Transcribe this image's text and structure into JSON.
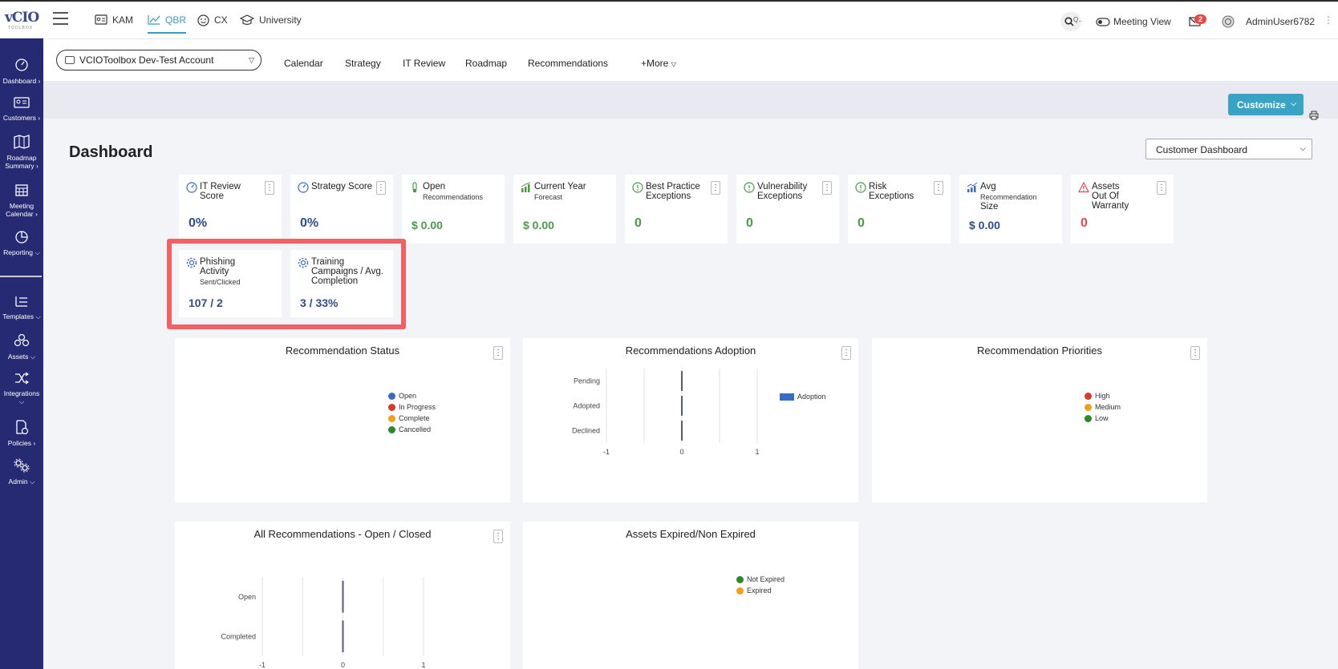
{
  "app": {
    "logo_text": "vCIO",
    "logo_sub": "TOOLBOX"
  },
  "sidebar": {
    "items": [
      {
        "label": "Dashboard",
        "icon": "gauge-icon"
      },
      {
        "label": "Customers",
        "icon": "id-card-icon"
      },
      {
        "label": "Roadmap Summary",
        "icon": "map-icon"
      },
      {
        "label": "Meeting Calendar",
        "icon": "calendar-icon"
      },
      {
        "label": "Reporting",
        "icon": "pie-chart-icon"
      },
      {
        "label": "Templates",
        "icon": "list-icon"
      },
      {
        "label": "Assets",
        "icon": "boxes-icon"
      },
      {
        "label": "Integrations",
        "icon": "shuffle-icon"
      },
      {
        "label": "Policies",
        "icon": "document-check-icon"
      },
      {
        "label": "Admin",
        "icon": "gears-icon"
      }
    ]
  },
  "topnav": {
    "tabs": [
      {
        "label": "KAM"
      },
      {
        "label": "QBR"
      },
      {
        "label": "CX"
      },
      {
        "label": "University"
      }
    ],
    "search_label": "Q..",
    "meeting_view": "Meeting View",
    "mail_count": "2",
    "username": "AdminUser6782"
  },
  "subbar": {
    "account": "VCIOToolbox Dev-Test Account",
    "tabs": [
      "Calendar",
      "Strategy",
      "IT Review",
      "Roadmap",
      "Recommendations"
    ],
    "more": "+More"
  },
  "toolbar": {
    "customize": "Customize"
  },
  "page": {
    "title": "Dashboard",
    "dashboard_select": "Customer Dashboard"
  },
  "cards": [
    {
      "title": "IT Review Score",
      "sub": "",
      "value": "0%",
      "value_color": "#2f4d8c"
    },
    {
      "title": "Strategy Score",
      "sub": "",
      "value": "0%",
      "value_color": "#2f4d8c"
    },
    {
      "title": "Open",
      "sub": "Recommendations",
      "value": "$ 0.00",
      "value_color": "#4a9a4a"
    },
    {
      "title": "Current Year",
      "sub": "Forecast",
      "value": "$ 0.00",
      "value_color": "#4a9a4a"
    },
    {
      "title": "Best Practice Exceptions",
      "sub": "",
      "value": "0",
      "value_color": "#4a9a4a"
    },
    {
      "title": "Vulnerability Exceptions",
      "sub": "",
      "value": "0",
      "value_color": "#4a9a4a"
    },
    {
      "title": "Risk Exceptions",
      "sub": "",
      "value": "0",
      "value_color": "#4a9a4a"
    },
    {
      "title": "Avg",
      "sub": "Recommendation",
      "title2": "Size",
      "value": "$ 0.00",
      "value_color": "#2f4d8c"
    },
    {
      "title": "Assets Out Of Warranty",
      "sub": "",
      "value": "0",
      "value_color": "#e84a4a"
    },
    {
      "title": "Phishing Activity",
      "sub": "Sent/Clicked",
      "value": "107 / 2",
      "value_color": "#2f4d8c"
    },
    {
      "title": "Training Campaigns / Avg. Completion",
      "sub": "",
      "value": "3 / 33%",
      "value_color": "#2f4d8c"
    }
  ],
  "panels": {
    "rec_status": {
      "title": "Recommendation Status",
      "legend": [
        "Open",
        "In Progress",
        "Complete",
        "Cancelled"
      ],
      "colors": [
        "#3a6bc4",
        "#d93a2a",
        "#f2a01a",
        "#2a8a2a"
      ]
    },
    "rec_adoption": {
      "title": "Recommendations Adoption",
      "legend": [
        "Adoption"
      ],
      "colors": [
        "#3a6bc4"
      ]
    },
    "rec_priorities": {
      "title": "Recommendation Priorities",
      "legend": [
        "High",
        "Medium",
        "Low"
      ],
      "colors": [
        "#d93a2a",
        "#f2a01a",
        "#2a8a2a"
      ]
    },
    "all_recs": {
      "title": "All Recommendations - Open / Closed"
    },
    "assets_expired": {
      "title": "Assets Expired/Non Expired",
      "legend": [
        "Not Expired",
        "Expired"
      ],
      "colors": [
        "#2a8a2a",
        "#f2a01a"
      ]
    }
  },
  "chart_data": [
    {
      "type": "bar",
      "title": "Recommendations Adoption",
      "categories": [
        "Pending",
        "Adopted",
        "Declined"
      ],
      "series": [
        {
          "name": "Adoption",
          "values": [
            0,
            0,
            0
          ]
        }
      ],
      "xlim": [
        -1,
        1
      ],
      "x_ticks": [
        "-1",
        "0",
        "1"
      ]
    },
    {
      "type": "bar",
      "title": "All Recommendations - Open / Closed",
      "categories": [
        "Open",
        "Completed"
      ],
      "series": [
        {
          "values": [
            0,
            0
          ]
        }
      ],
      "xlim": [
        -1,
        1
      ],
      "x_ticks": [
        "-1",
        "0",
        "1"
      ]
    }
  ]
}
